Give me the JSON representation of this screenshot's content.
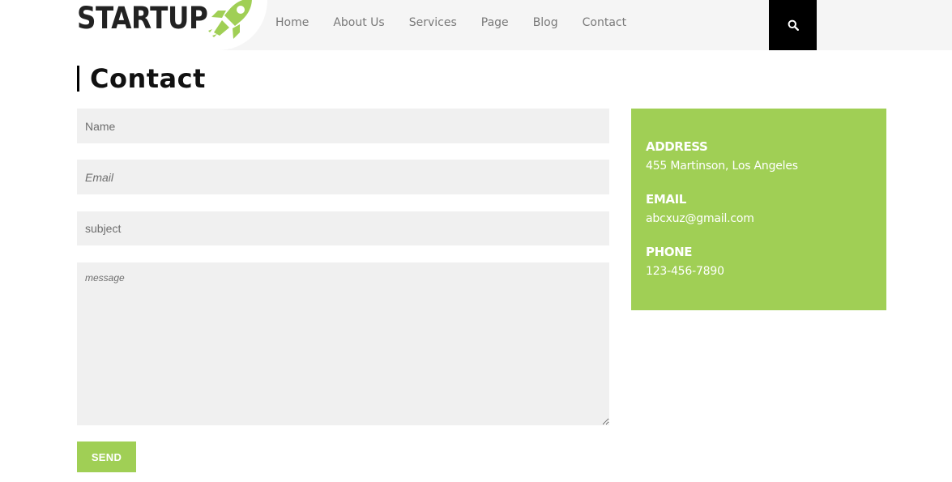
{
  "header": {
    "logo_text": "STARTUP",
    "logo_icon": "rocket-icon",
    "nav": [
      "Home",
      "About Us",
      "Services",
      "Page",
      "Blog",
      "Contact"
    ],
    "search_icon": "search-icon"
  },
  "page": {
    "title": "Contact"
  },
  "form": {
    "name_placeholder": "Name",
    "email_placeholder": "Email",
    "subject_placeholder": "subject",
    "message_placeholder": "message",
    "send_label": "SEND"
  },
  "contact_info": {
    "address_label": "ADDRESS",
    "address_value": "455 Martinson, Los Angeles",
    "email_label": "EMAIL",
    "email_value": "abcxuz@gmail.com",
    "phone_label": "PHONE",
    "phone_value": "123-456-7890"
  },
  "colors": {
    "accent": "#a0cf55",
    "header_bg": "#f5f5f5",
    "field_bg": "#f0f0f0",
    "search_bg": "#000000"
  }
}
